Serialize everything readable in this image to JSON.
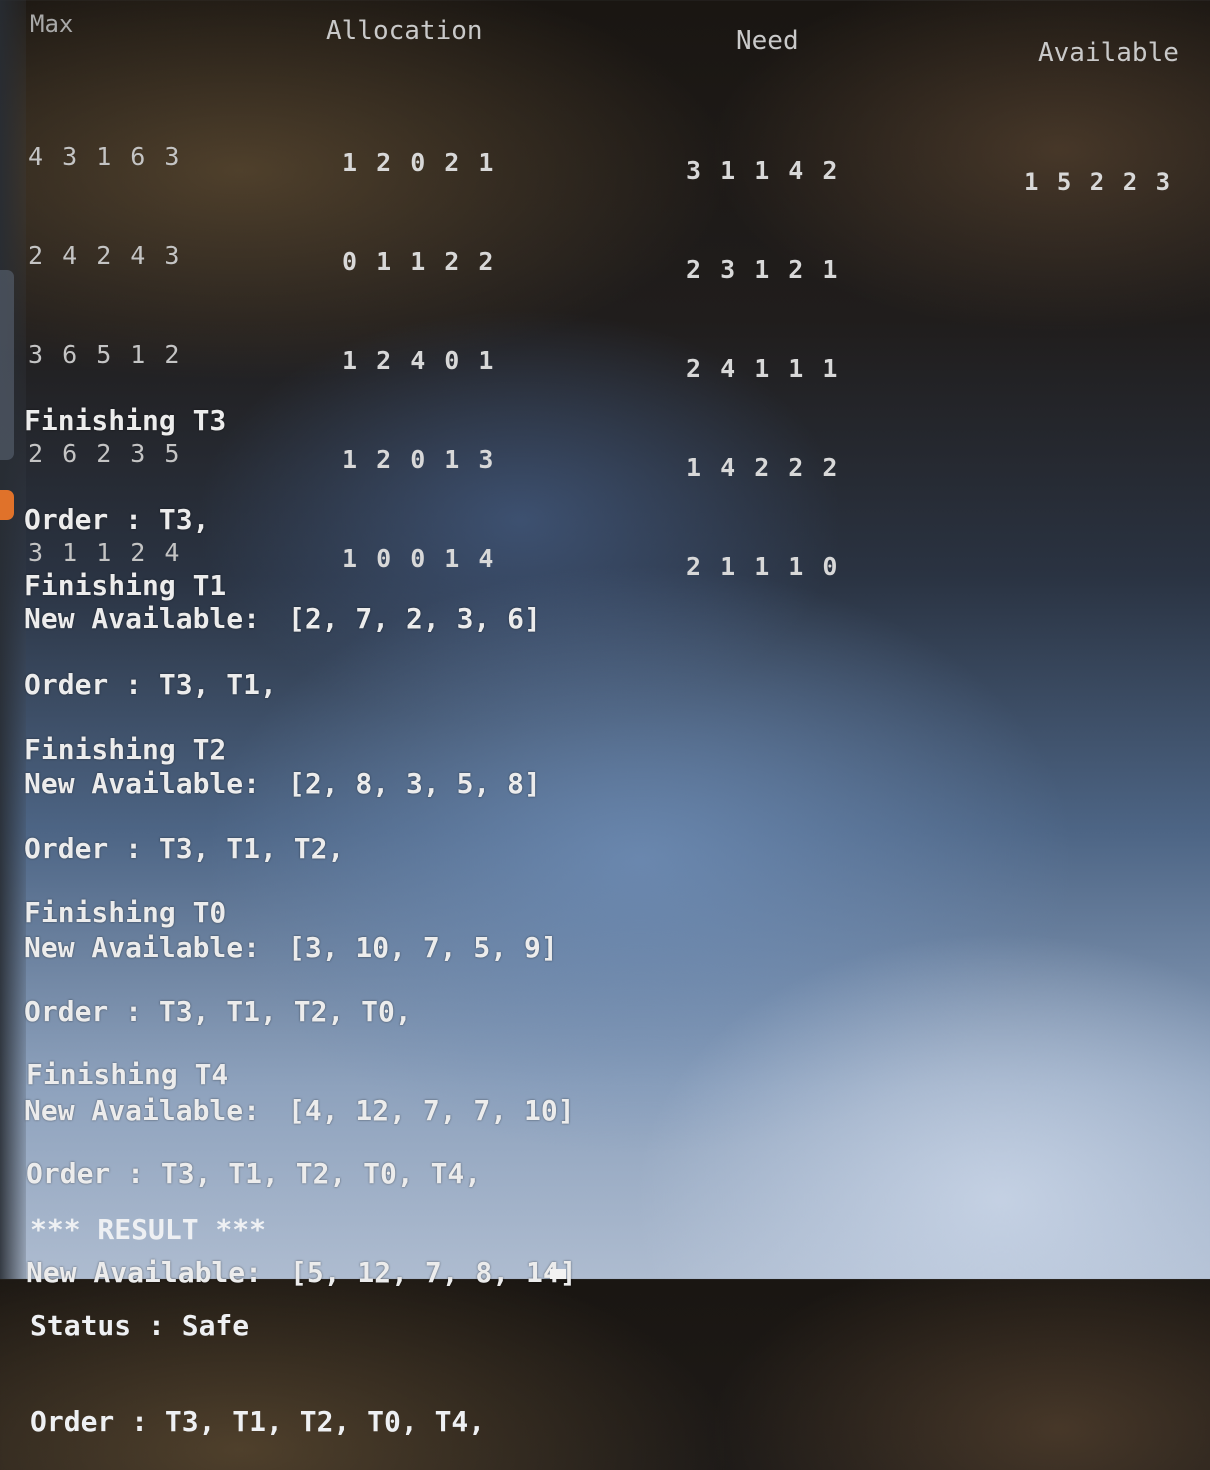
{
  "headers": {
    "max": "Max",
    "allocation": "Allocation",
    "need": "Need",
    "available": "Available"
  },
  "matrices": {
    "max": [
      "4 3 1 6 3",
      "2 4 2 4 3",
      "3 6 5 1 2",
      "2 6 2 3 5",
      "3 1 1 2 4"
    ],
    "allocation": [
      "1 2 0 2 1",
      "0 1 1 2 2",
      "1 2 4 0 1",
      "1 2 0 1 3",
      "1 0 0 1 4"
    ],
    "need": [
      "3 1 1 4 2",
      "2 3 1 2 1",
      "2 4 1 1 1",
      "1 4 2 2 2",
      "2 1 1 1 0"
    ],
    "available": [
      "1 5 2 2 3"
    ]
  },
  "steps": [
    {
      "finishing": "Finishing T3",
      "order": "Order : T3,",
      "available_label": "New Available:",
      "available_value": "[2, 7, 2, 3, 6]"
    },
    {
      "finishing": "Finishing T1",
      "order": "Order : T3, T1,",
      "available_label": "New Available:",
      "available_value": "[2, 8, 3, 5, 8]"
    },
    {
      "finishing": "Finishing T2",
      "order": "Order : T3, T1, T2,",
      "available_label": "New Available:",
      "available_value": "[3, 10, 7, 5, 9]"
    },
    {
      "finishing": "Finishing T0",
      "order": "Order : T3, T1, T2, T0,",
      "available_label": "New Available:",
      "available_value": "[4, 12, 7, 7, 10]"
    },
    {
      "finishing": "Finishing T4",
      "order": "Order : T3, T1, T2, T0, T4,",
      "available_label": "New Available:",
      "available_value": "[5, 12, 7, 8, 14]"
    }
  ],
  "result": {
    "title": "*** RESULT ***",
    "status": "Status : Safe",
    "order": "Order : T3, T1, T2, T0, T4,"
  },
  "colors": {
    "text": "#ececec",
    "header_text": "#c9c9c9"
  }
}
